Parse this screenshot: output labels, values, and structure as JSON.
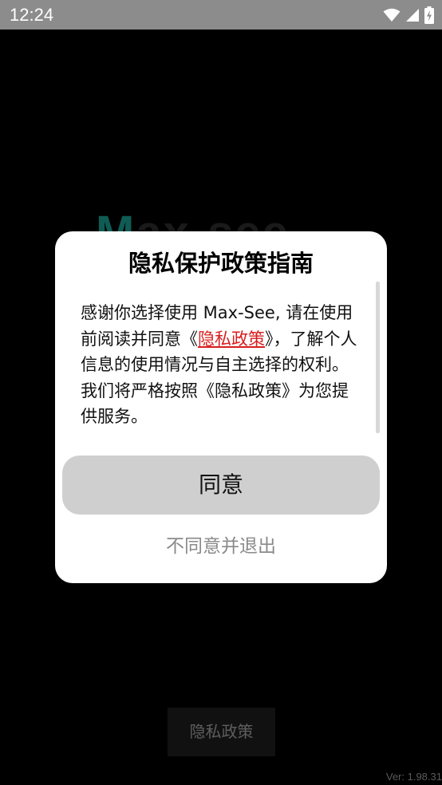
{
  "status_bar": {
    "time": "12:24",
    "icons": [
      "wifi-icon",
      "signal-icon",
      "battery-charging-icon"
    ]
  },
  "background": {
    "logo_first": "M",
    "logo_rest": "ax-see"
  },
  "dialog": {
    "title": "隐私保护政策指南",
    "body": {
      "text_before_link": "感谢你选择使用 Max-See, 请在使用前阅读并同意《",
      "link_text": "隐私政策",
      "text_after_link": "》，了解个人信息的使用情况与自主选择的权利。",
      "paragraph2": "我们将严格按照《隐私政策》为您提供服务。"
    },
    "agree_label": "同意",
    "disagree_label": "不同意并退出"
  },
  "bottom": {
    "privacy_button_label": "隐私政策",
    "version": "Ver: 1.98.31"
  },
  "colors": {
    "status_bar_bg": "#8c8c8c",
    "page_bg": "#000000",
    "dialog_bg": "#ffffff",
    "link": "#d81e1e",
    "agree_button_bg": "#cfcfcf",
    "disagree_text": "#8a8a8a",
    "logo_accent": "#0f5c55"
  }
}
